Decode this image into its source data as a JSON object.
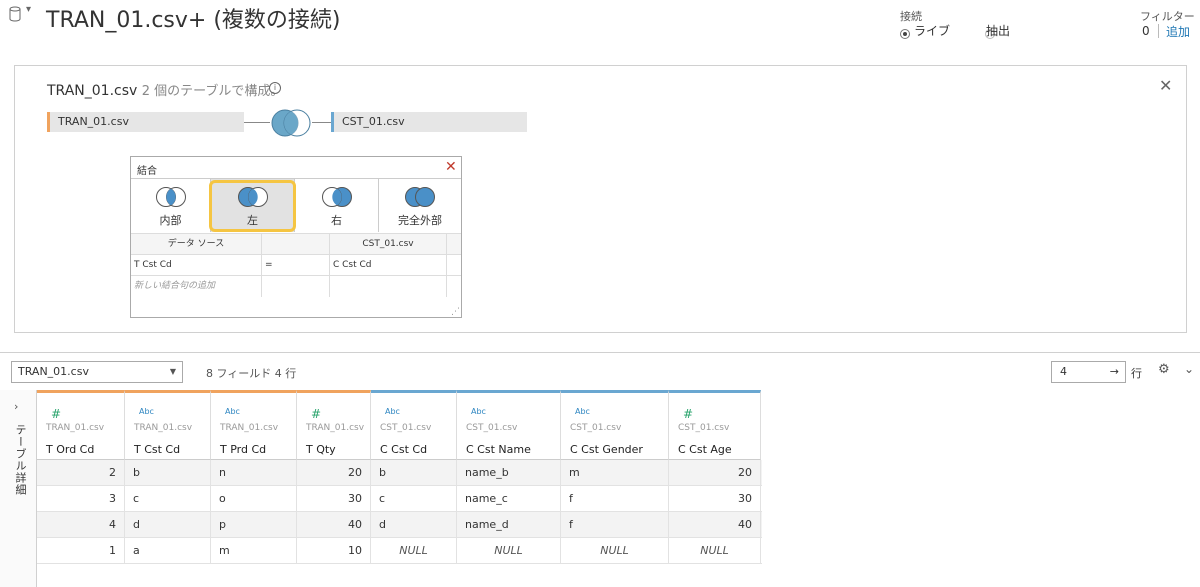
{
  "header": {
    "title": "TRAN_01.csv+ (複数の接続)",
    "connection_label": "接続",
    "live_label": "ライブ",
    "extract_label": "抽出",
    "filter_label": "フィルター",
    "filter_count": "0",
    "filter_add": "追加"
  },
  "canvas": {
    "title_main": "TRAN_01.csv",
    "title_sub": "2 個のテーブルで構成。",
    "left_table": "TRAN_01.csv",
    "right_table": "CST_01.csv"
  },
  "join_dialog": {
    "title": "結合",
    "types": [
      "内部",
      "左",
      "右",
      "完全外部"
    ],
    "selected": "左",
    "grid_headers": [
      "データ ソース",
      "",
      "CST_01.csv"
    ],
    "clause": {
      "left": "T Cst Cd",
      "op": "=",
      "right": "C Cst Cd"
    },
    "add_clause": "新しい結合句の追加"
  },
  "toolbar": {
    "table_select": "TRAN_01.csv",
    "field_info": "8 フィールド 4 行",
    "rows_value": "4",
    "rows_label": "行"
  },
  "side_panel": {
    "label": "テーブル詳細"
  },
  "grid": {
    "columns": [
      {
        "type": "#",
        "source": "TRAN_01.csv",
        "name": "T Ord Cd"
      },
      {
        "type": "Abc",
        "source": "TRAN_01.csv",
        "name": "T Cst Cd"
      },
      {
        "type": "Abc",
        "source": "TRAN_01.csv",
        "name": "T Prd Cd"
      },
      {
        "type": "#",
        "source": "TRAN_01.csv",
        "name": "T Qty"
      },
      {
        "type": "Abc",
        "source": "CST_01.csv",
        "name": "C Cst Cd"
      },
      {
        "type": "Abc",
        "source": "CST_01.csv",
        "name": "C Cst Name"
      },
      {
        "type": "Abc",
        "source": "CST_01.csv",
        "name": "C Cst Gender"
      },
      {
        "type": "#",
        "source": "CST_01.csv",
        "name": "C Cst Age"
      }
    ],
    "rows": [
      [
        "2",
        "b",
        "n",
        "20",
        "b",
        "name_b",
        "m",
        "20"
      ],
      [
        "3",
        "c",
        "o",
        "30",
        "c",
        "name_c",
        "f",
        "30"
      ],
      [
        "4",
        "d",
        "p",
        "40",
        "d",
        "name_d",
        "f",
        "40"
      ],
      [
        "1",
        "a",
        "m",
        "10",
        "NULL",
        "NULL",
        "NULL",
        "NULL"
      ]
    ]
  },
  "colors": {
    "left_table_accent": "#f0a35e",
    "right_table_accent": "#6aa7d1",
    "venn_fill": "#4a90c8",
    "highlight": "#f5c542",
    "link": "#1f77b4"
  }
}
